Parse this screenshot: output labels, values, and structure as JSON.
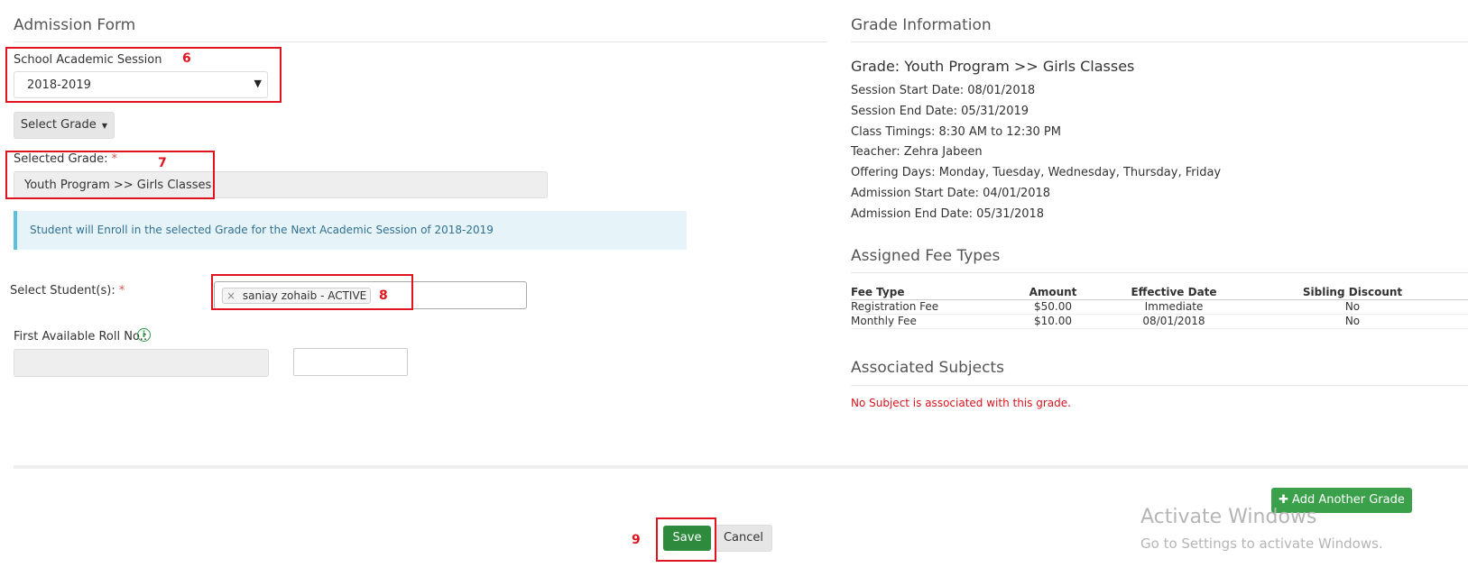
{
  "left": {
    "title": "Admission Form",
    "session_label": "School Academic Session",
    "session_value": "2018-2019",
    "select_grade_label": "Select Grade",
    "selected_grade_label": "Selected Grade:",
    "required_mark": "*",
    "selected_grade_value": "Youth Program >> Girls Classes",
    "notice": "Student will Enroll in the selected Grade for the Next Academic Session of 2018-2019",
    "select_students_label": "Select Student(s):",
    "student_tag": "saniay zohaib - ACTIVE",
    "tag_remove": "×",
    "roll_label": "First Available Roll No.:",
    "roll_value": "",
    "roll_input_value": ""
  },
  "right": {
    "title": "Grade Information",
    "grade_heading": "Grade: Youth Program >> Girls Classes",
    "details": [
      "Session Start Date: 08/01/2018",
      "Session End Date: 05/31/2019",
      "Class Timings: 8:30 AM to 12:30 PM",
      "Teacher: Zehra Jabeen",
      "Offering Days: Monday, Tuesday, Wednesday, Thursday, Friday",
      "Admission Start Date: 04/01/2018",
      "Admission End Date: 05/31/2018"
    ],
    "fee_title": "Assigned Fee Types",
    "fee_headers": [
      "Fee Type",
      "Amount",
      "Effective Date",
      "Sibling Discount"
    ],
    "fee_rows": [
      [
        "Registration Fee",
        "$50.00",
        "Immediate",
        "No"
      ],
      [
        "Monthly Fee",
        "$10.00",
        "08/01/2018",
        "No"
      ]
    ],
    "subjects_title": "Associated Subjects",
    "subjects_empty": "No Subject is associated with this grade."
  },
  "footer": {
    "add_grade": "Add Another Grade",
    "save": "Save",
    "cancel": "Cancel"
  },
  "annotations": [
    "6",
    "7",
    "8",
    "9"
  ],
  "watermark": {
    "line1": "Activate Windows",
    "line2": "Go to Settings to activate Windows."
  },
  "colors": {
    "annotation_red": "#e0141e",
    "save_green": "#2e8b3e",
    "add_green": "#3aa04a",
    "notice_bg": "#e6f4fa",
    "notice_border": "#5bc0de"
  }
}
